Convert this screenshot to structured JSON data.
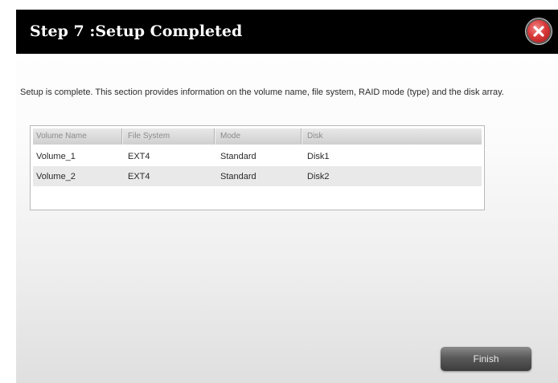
{
  "dialog": {
    "title": "Step 7 :Setup Completed",
    "description": "Setup is complete. This section provides information on the volume name, file system, RAID mode (type) and the disk array."
  },
  "table": {
    "columns": [
      "Volume Name",
      "File System",
      "Mode",
      "Disk"
    ],
    "rows": [
      [
        "Volume_1",
        "EXT4",
        "Standard",
        "Disk1"
      ],
      [
        "Volume_2",
        "EXT4",
        "Standard",
        "Disk2"
      ]
    ]
  },
  "buttons": {
    "finish_label": "Finish"
  },
  "icons": {
    "close": "close-icon"
  },
  "colors": {
    "title_bar": "#000000",
    "close_button": "#d93a3a",
    "finish_button": "#5a5a5a"
  }
}
